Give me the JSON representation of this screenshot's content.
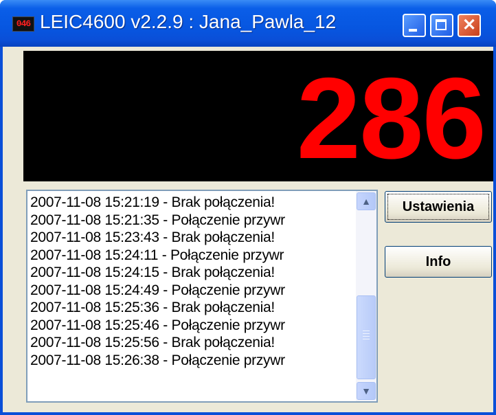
{
  "window": {
    "title": "LEIC4600 v2.2.9 : Jana_Pawla_12",
    "app_icon_text": "046"
  },
  "display": {
    "value": "286",
    "color": "#ff0000",
    "background": "#000000"
  },
  "log": {
    "entries": [
      "2007-11-08 15:21:19 - Brak połączenia!",
      "2007-11-08 15:21:35 - Połączenie przywr",
      "2007-11-08 15:23:43 - Brak połączenia!",
      "2007-11-08 15:24:11 - Połączenie przywr",
      "2007-11-08 15:24:15 - Brak połączenia!",
      "2007-11-08 15:24:49 - Połączenie przywr",
      "2007-11-08 15:25:36 - Brak połączenia!",
      "2007-11-08 15:25:46 - Połączenie przywr",
      "2007-11-08 15:25:56 - Brak połączenia!",
      "2007-11-08 15:26:38 - Połączenie przywr"
    ]
  },
  "buttons": {
    "settings_label": "Ustawienia",
    "info_label": "Info"
  },
  "icons": {
    "minimize": "minimize-icon",
    "maximize": "maximize-icon",
    "close": "close-icon",
    "scroll_up": "chevron-up-icon",
    "scroll_down": "chevron-down-icon"
  }
}
